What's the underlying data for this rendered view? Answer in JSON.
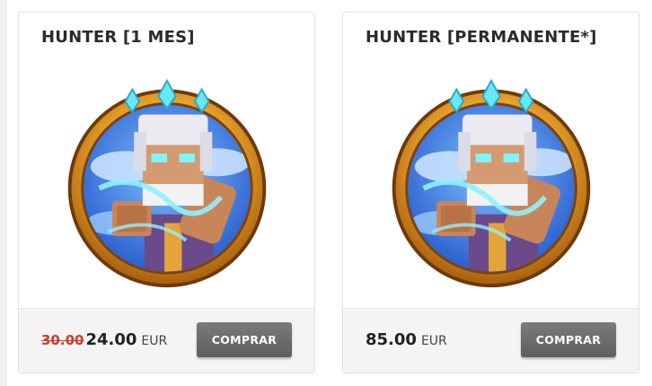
{
  "colors": {
    "old_price": "#d23a2e",
    "button_bg": "#6b6b6b",
    "medallion_ring": "#e7a12a",
    "medallion_sky": "#3a7fe0",
    "crystal": "#67e8f5"
  },
  "products": [
    {
      "title": "HUNTER [1 MES]",
      "image_icon": "hunter-rank-medallion",
      "old_price": "30.00",
      "price": "24.00",
      "currency": "EUR",
      "button_label": "COMPRAR"
    },
    {
      "title": "HUNTER [PERMANENTE*]",
      "image_icon": "hunter-rank-medallion",
      "price": "85.00",
      "currency": "EUR",
      "button_label": "COMPRAR"
    }
  ]
}
